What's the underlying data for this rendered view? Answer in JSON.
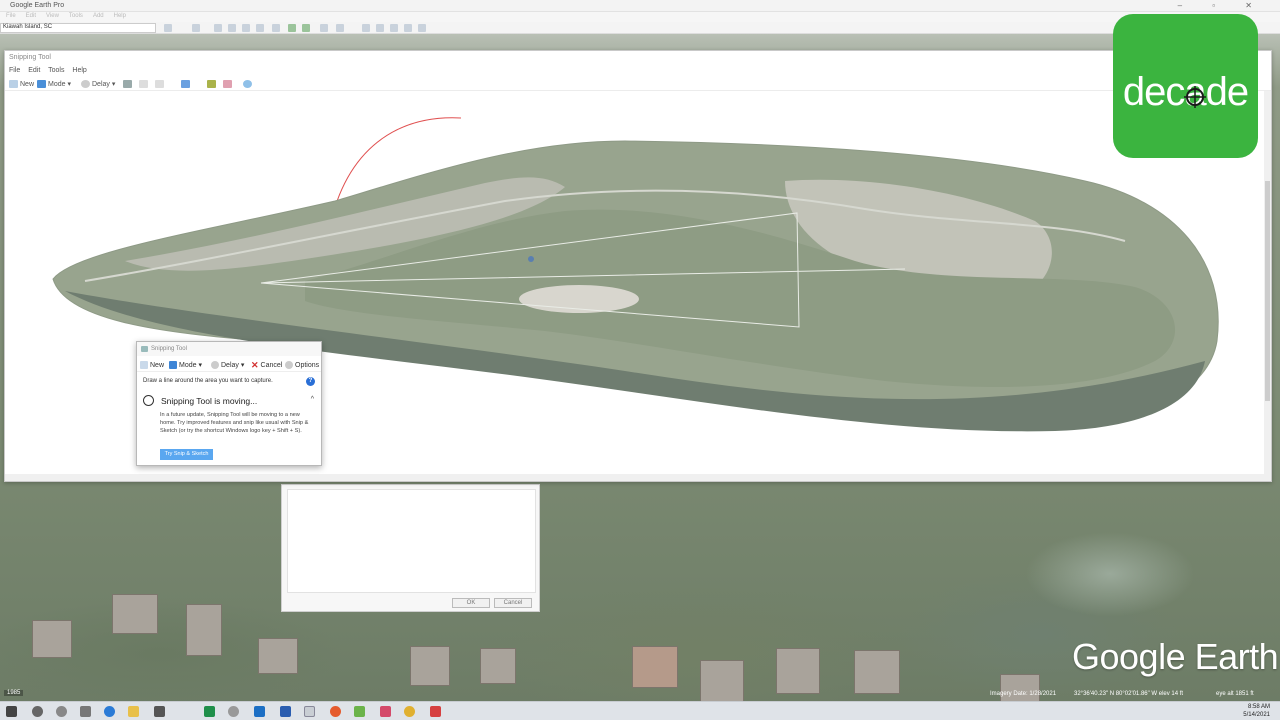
{
  "google_earth": {
    "window_title": "Google Earth Pro",
    "search_value": "Kiawah Island, SC",
    "logo_text": "Google Earth",
    "status": {
      "scale": "1985",
      "imagery_date": "Imagery Date: 1/28/2021",
      "coordinates": "32°36'40.23\" N   80°02'01.86\" W   elev    14 ft",
      "eye_alt": "eye alt  1851 ft"
    },
    "dialog": {
      "ok_label": "OK",
      "cancel_label": "Cancel"
    }
  },
  "snipping_main": {
    "title": "Snipping Tool",
    "menus": [
      "File",
      "Edit",
      "Tools",
      "Help"
    ],
    "toolbar": {
      "new_label": "New",
      "mode_label": "Mode",
      "delay_label": "Delay"
    }
  },
  "snipping_small": {
    "title": "Snipping Tool",
    "toolbar": {
      "new_label": "New",
      "mode_label": "Mode",
      "delay_label": "Delay",
      "cancel_label": "Cancel",
      "options_label": "Options"
    },
    "hint": "Draw a line around the area you want to capture.",
    "help_icon": "?",
    "notice_title": "Snipping Tool is moving...",
    "notice_body": "In a future update, Snipping Tool will be moving to a new home. Try improved features and snip like usual with Snip & Sketch (or try the shortcut Windows logo key + Shift + S).",
    "try_button": "Try Snip & Sketch"
  },
  "brand": {
    "decade_word": "decade",
    "decade_color": "#3bb43f"
  },
  "taskbar": {
    "time": "8:58 AM",
    "date": "5/14/2021"
  }
}
